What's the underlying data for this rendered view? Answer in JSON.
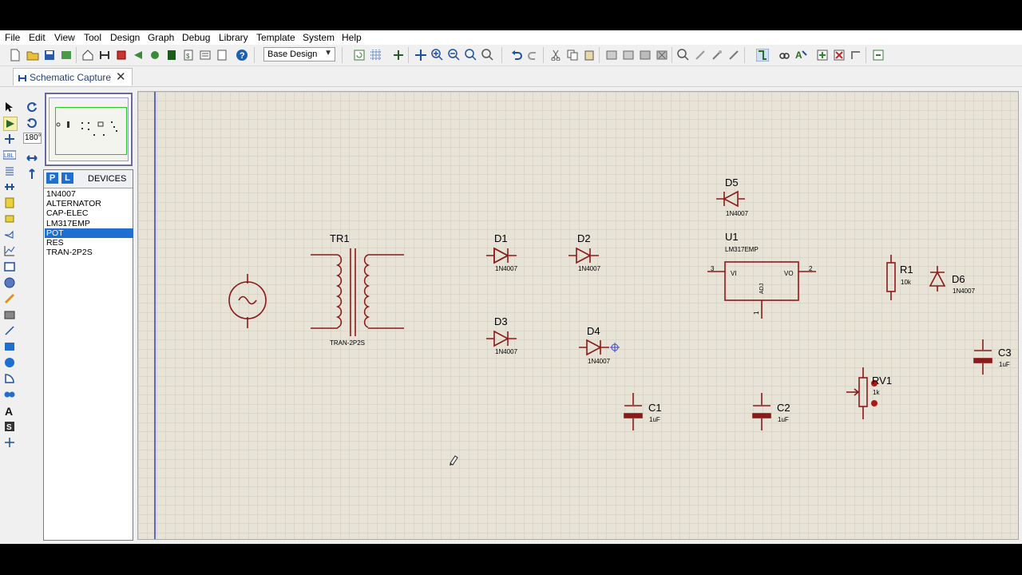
{
  "menu": [
    "File",
    "Edit",
    "View",
    "Tool",
    "Design",
    "Graph",
    "Debug",
    "Library",
    "Template",
    "System",
    "Help"
  ],
  "toolbar": {
    "design_select": "Base Design"
  },
  "tab": {
    "label": "Schematic Capture",
    "close": "✕"
  },
  "rotation": {
    "angle": "180°"
  },
  "devices_panel": {
    "p_label": "P",
    "l_label": "L",
    "title": "DEVICES",
    "items": [
      "1N4007",
      "ALTERNATOR",
      "CAP-ELEC",
      "LM317EMP",
      "POT",
      "RES",
      "TRAN-2P2S"
    ],
    "selected": "POT"
  },
  "components": {
    "tr1": {
      "ref": "TR1",
      "value": "TRAN-2P2S"
    },
    "d1": {
      "ref": "D1",
      "value": "1N4007"
    },
    "d2": {
      "ref": "D2",
      "value": "1N4007"
    },
    "d3": {
      "ref": "D3",
      "value": "1N4007"
    },
    "d4": {
      "ref": "D4",
      "value": "1N4007"
    },
    "d5": {
      "ref": "D5",
      "value": "1N4007"
    },
    "d6": {
      "ref": "D6",
      "value": "1N4007"
    },
    "u1": {
      "ref": "U1",
      "value": "LM317EMP",
      "pin_vi": "VI",
      "pin_vo": "VO",
      "pin_adj": "ADJ",
      "pin3": "3",
      "pin2": "2",
      "pin1": "1"
    },
    "r1": {
      "ref": "R1",
      "value": "10k"
    },
    "rv1": {
      "ref": "RV1",
      "value": "1k"
    },
    "c1": {
      "ref": "C1",
      "value": "1uF"
    },
    "c2": {
      "ref": "C2",
      "value": "1uF"
    },
    "c3": {
      "ref": "C3",
      "value": "1uF"
    }
  },
  "colors": {
    "component": "#8b1a1a",
    "grid_bg": "#e7e3d6",
    "selection": "#1f6fd0",
    "accent_blue": "#1f6fd0"
  }
}
